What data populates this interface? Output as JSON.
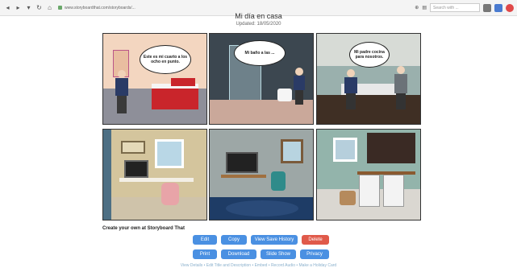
{
  "browser": {
    "url": "www.storyboardthat.com/storyboards/...",
    "search_placeholder": "Search with ..."
  },
  "page": {
    "title": "Mi día en casa",
    "updated": "Updated: 18/05/2020"
  },
  "panels": {
    "p1_bubble": "Este es mi cuarto a los ocho en punto.",
    "p2_bubble": "Mi baño a las ...",
    "p3_bubble": "Mi padre cocina para nosotros."
  },
  "credit": "Create your own at Storyboard That",
  "buttons": {
    "edit": "Edit",
    "copy": "Copy",
    "history": "View Save History",
    "delete": "Delete",
    "print": "Print",
    "download": "Download",
    "slideshow": "Slide Show",
    "privacy": "Privacy"
  },
  "links": "View Details • Edit Title and Description • Embed • Record Audio • Make a Holiday Card",
  "colors": {
    "button_blue": "#4a90e2",
    "button_red": "#e05a4a"
  }
}
